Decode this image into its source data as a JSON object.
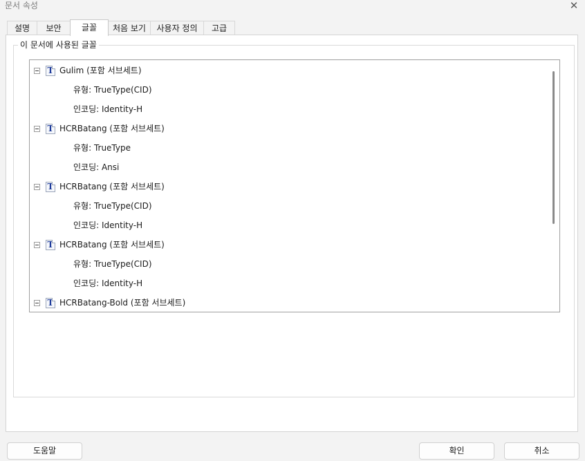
{
  "window": {
    "title": "문서 속성",
    "close_glyph": "✕"
  },
  "tabs": [
    {
      "label": "설명"
    },
    {
      "label": "보안"
    },
    {
      "label": "글꼴",
      "active": true
    },
    {
      "label": "처음 보기"
    },
    {
      "label": "사용자 정의"
    },
    {
      "label": "고급"
    }
  ],
  "fonts_group": {
    "legend": "이 문서에 사용된 글꼴"
  },
  "font_tree": [
    {
      "name": "Gulim (포함 서브세트)",
      "icon": "truetype-font-icon",
      "props": [
        "유형: TrueType(CID)",
        "인코딩: Identity-H"
      ]
    },
    {
      "name": "HCRBatang (포함 서브세트)",
      "icon": "truetype-font-icon",
      "props": [
        "유형: TrueType",
        "인코딩: Ansi"
      ]
    },
    {
      "name": "HCRBatang (포함 서브세트)",
      "icon": "truetype-font-icon",
      "props": [
        "유형: TrueType(CID)",
        "인코딩: Identity-H"
      ]
    },
    {
      "name": "HCRBatang (포함 서브세트)",
      "icon": "truetype-font-icon",
      "props": [
        "유형: TrueType(CID)",
        "인코딩: Identity-H"
      ]
    },
    {
      "name": "HCRBatang-Bold (포함 서브세트)",
      "icon": "truetype-font-icon",
      "props": []
    }
  ],
  "icons": {
    "font_glyph": "T"
  },
  "buttons": {
    "help": "도움말",
    "ok": "확인",
    "cancel": "취소"
  }
}
